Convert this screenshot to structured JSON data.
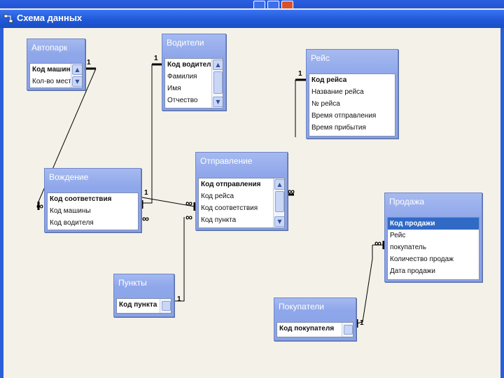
{
  "window": {
    "title": "Схема данных"
  },
  "tables": {
    "avtopark": {
      "title": "Автопарк",
      "fields": [
        "Код машины",
        "Кол-во мест"
      ]
    },
    "voditeli": {
      "title": "Водители",
      "fields": [
        "Код водителя",
        "Фамилия",
        "Имя",
        "Отчество"
      ]
    },
    "reys": {
      "title": "Рейс",
      "fields": [
        "Код рейса",
        "Название рейса",
        "№ рейса",
        "Время отправления",
        "Время прибытия"
      ]
    },
    "vozhdenie": {
      "title": "Вождение",
      "fields": [
        "Код соответствия",
        "Код машины",
        "Код водителя"
      ]
    },
    "otpravlenie": {
      "title": "Отправление",
      "fields": [
        "Код отправления",
        "Код рейса",
        "Код соответствия",
        "Код пункта"
      ]
    },
    "prodazha": {
      "title": "Продажа",
      "fields": [
        "Код продажи",
        "Рейс",
        "покупатель",
        "Количество продаж",
        "Дата продажи"
      ]
    },
    "punkty": {
      "title": "Пункты",
      "fields": [
        "Код пункта"
      ]
    },
    "pokupateli": {
      "title": "Покупатели",
      "fields": [
        "Код покупателя"
      ]
    }
  },
  "relation_labels": {
    "one": "1",
    "many": "∞"
  }
}
